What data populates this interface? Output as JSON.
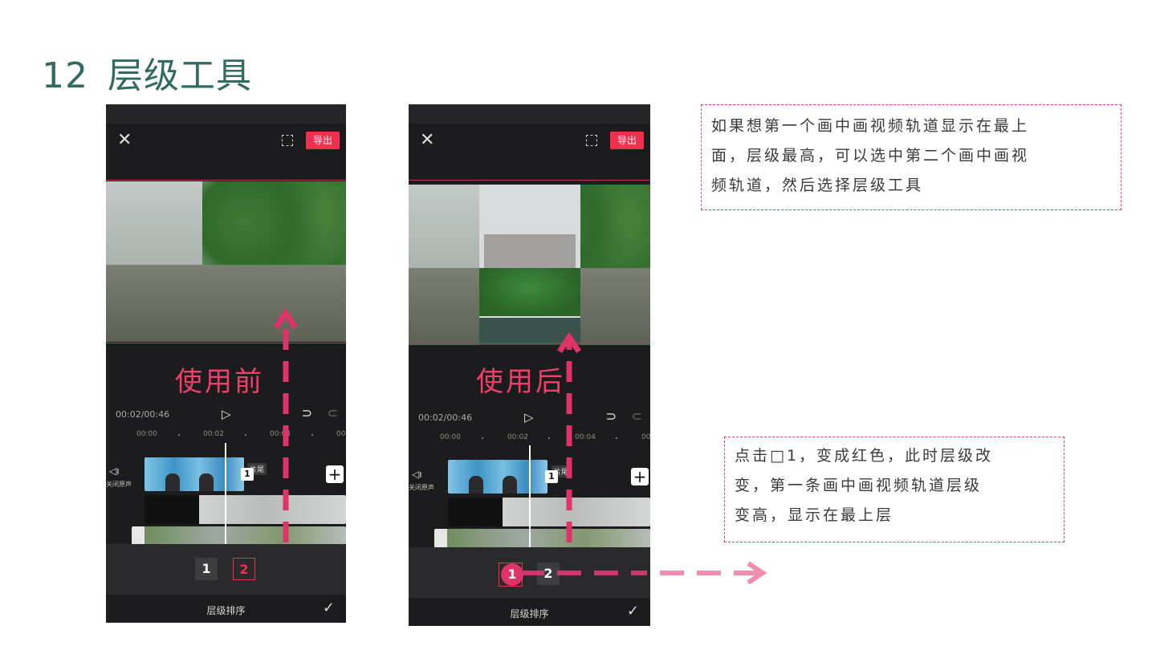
{
  "slide": {
    "number": "12",
    "title": "层级工具"
  },
  "editor": {
    "export_label": "导出",
    "timecode": "00:02/00:46",
    "ruler_ticks": [
      "00:00",
      "00:02",
      "00:04",
      "00:"
    ],
    "audio_label": "关闭原声",
    "tail_label": "片尾",
    "playhead_label": "1",
    "layer_panel_title": "层级排序"
  },
  "before": {
    "caption": "使用前",
    "layer_buttons": [
      "1",
      "2"
    ],
    "active_layer": "2"
  },
  "after": {
    "caption": "使用后",
    "layer_buttons": [
      "1",
      "2"
    ],
    "active_layer": "1"
  },
  "notes": {
    "top": [
      "如果想第一个画中画视频轨道显示在最上",
      "面，层级最高，可以选中第二个画中画视",
      "频轨道，然后选择层级工具"
    ],
    "bottom": [
      "点击□1，变成红色，此时层级改",
      "变，第一条画中画视频轨道层级",
      "变高，显示在最上层"
    ]
  },
  "colors": {
    "accent": "#f0314e",
    "arrow": "#e0336a",
    "note_border": "#e23f77",
    "title": "#2f6b5e"
  }
}
